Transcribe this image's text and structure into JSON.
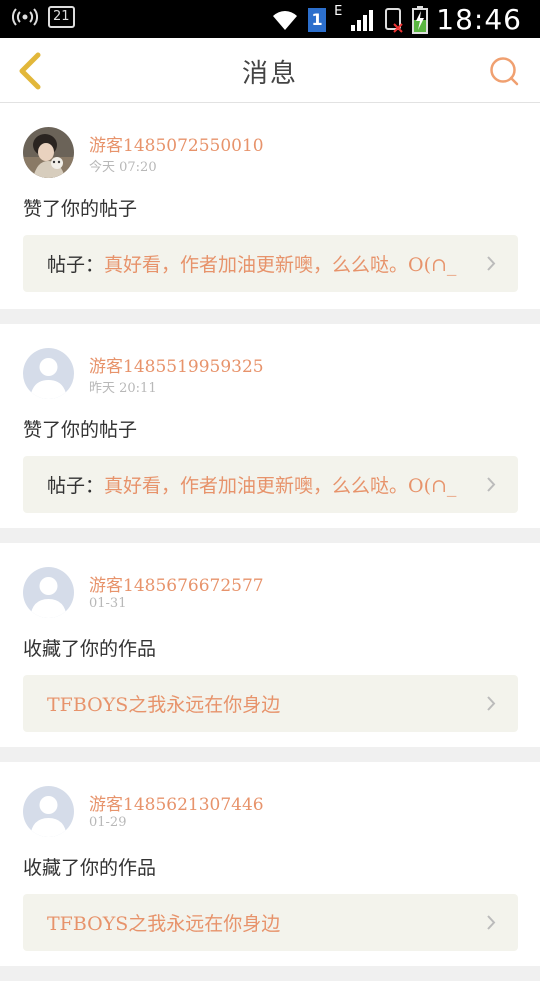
{
  "statusbar": {
    "left_badge": "21",
    "sim": "1",
    "network": "E",
    "time": "18:46"
  },
  "header": {
    "title": "消息",
    "back_icon": "chevron-left-icon",
    "search_icon": "search-icon"
  },
  "colors": {
    "accent": "#e7936b",
    "back": "#e2b73a",
    "card_ref_bg": "#f3f3ec"
  },
  "notifications": [
    {
      "user": "游客1485072550010",
      "time": "今天 07:20",
      "action": "赞了你的帖子",
      "ref_prefix": "帖子：",
      "ref_text": "真好看，作者加油更新噢，么么哒。O(∩_",
      "avatar": "photo"
    },
    {
      "user": "游客1485519959325",
      "time": "昨天 20:11",
      "action": "赞了你的帖子",
      "ref_prefix": "帖子：",
      "ref_text": "真好看，作者加油更新噢，么么哒。O(∩_",
      "avatar": "default"
    },
    {
      "user": "游客1485676672577",
      "time": "01-31",
      "action": "收藏了你的作品",
      "ref_prefix": "",
      "ref_text": "TFBOYS之我永远在你身边",
      "avatar": "default"
    },
    {
      "user": "游客1485621307446",
      "time": "01-29",
      "action": "收藏了你的作品",
      "ref_prefix": "",
      "ref_text": "TFBOYS之我永远在你身边",
      "avatar": "default"
    }
  ]
}
